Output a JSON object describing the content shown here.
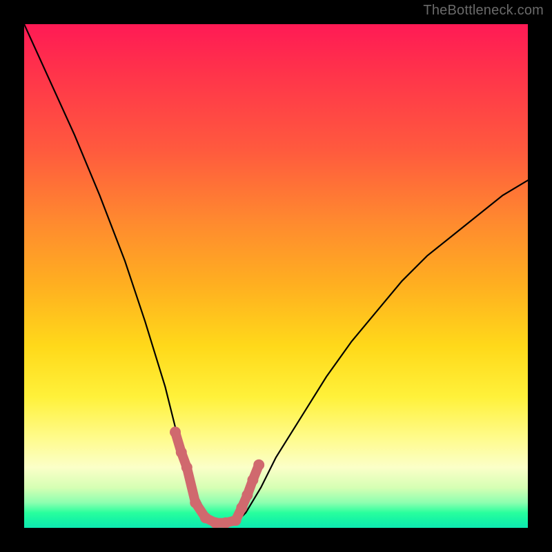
{
  "watermark": "TheBottleneck.com",
  "chart_data": {
    "type": "line",
    "title": "",
    "xlabel": "",
    "ylabel": "",
    "xlim": [
      0,
      100
    ],
    "ylim": [
      0,
      100
    ],
    "series": [
      {
        "name": "bottleneck-curve",
        "x": [
          0,
          5,
          10,
          15,
          20,
          24,
          28,
          30,
          32,
          34,
          36,
          38,
          40,
          42,
          44,
          47,
          50,
          55,
          60,
          65,
          70,
          75,
          80,
          85,
          90,
          95,
          100
        ],
        "values": [
          100,
          89,
          78,
          66,
          53,
          41,
          28,
          20,
          13,
          7,
          3,
          1,
          1,
          1,
          3,
          8,
          14,
          22,
          30,
          37,
          43,
          49,
          54,
          58,
          62,
          66,
          69
        ]
      }
    ],
    "colors": {
      "curve": "#000000",
      "markers": "#d0696e",
      "background_top": "#ff1a55",
      "background_mid": "#ffd91a",
      "background_bottom": "#16f4a5",
      "frame": "#000000"
    },
    "markers": {
      "description": "salmon dotted segments near curve bottom",
      "x": [
        30.0,
        31.2,
        32.3,
        34.0,
        36.0,
        38.0,
        40.0,
        42.0,
        43.2,
        44.3,
        45.4,
        46.6
      ],
      "values": [
        19.0,
        15.0,
        12.0,
        5.0,
        2.0,
        1.0,
        1.0,
        1.5,
        4.0,
        6.5,
        9.5,
        12.5
      ]
    }
  }
}
